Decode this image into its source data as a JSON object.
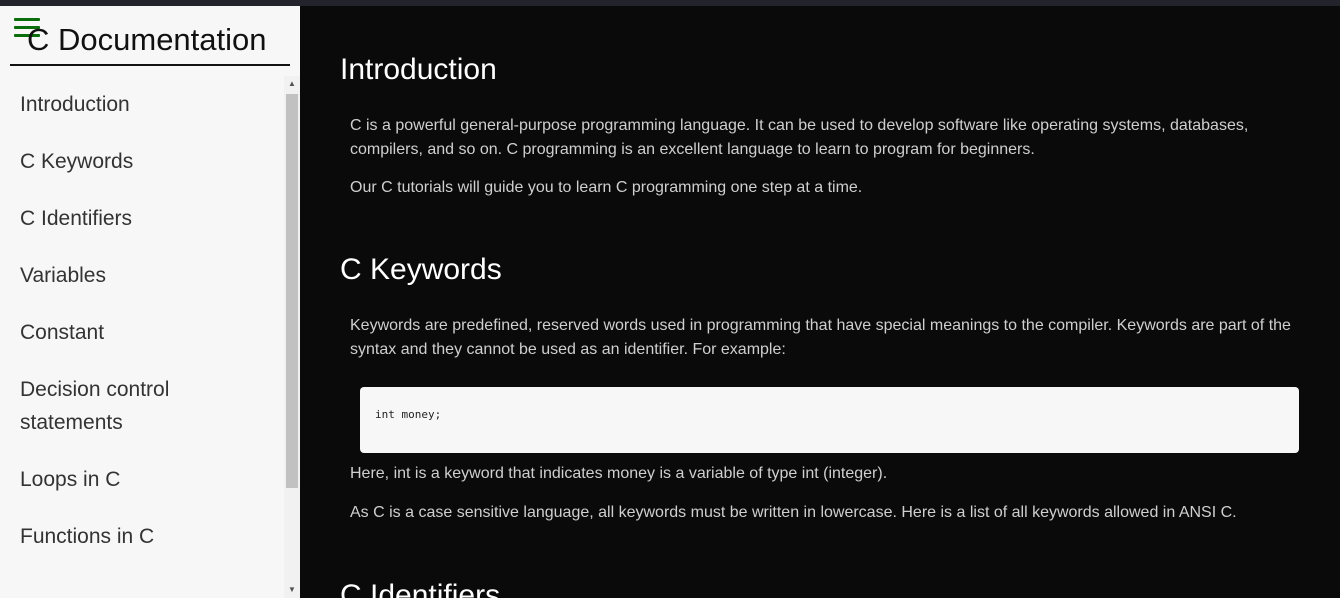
{
  "sidebar": {
    "title": "C Documentation",
    "menu_icon": "hamburger-icon",
    "items": [
      {
        "label": "Introduction"
      },
      {
        "label": "C Keywords"
      },
      {
        "label": "C Identifiers"
      },
      {
        "label": "Variables"
      },
      {
        "label": "Constant"
      },
      {
        "label": "Decision control statements"
      },
      {
        "label": "Loops in C"
      },
      {
        "label": "Functions in C"
      }
    ]
  },
  "main": {
    "sections": [
      {
        "heading": "Introduction",
        "paragraphs": [
          "C is a powerful general-purpose programming language. It can be used to develop software like operating systems, databases, compilers, and so on. C programming is an excellent language to learn to program for beginners.",
          "Our C tutorials will guide you to learn C programming one step at a time."
        ]
      },
      {
        "heading": "C Keywords",
        "paragraphs": [
          "Keywords are predefined, reserved words used in programming that have special meanings to the compiler. Keywords are part of the syntax and they cannot be used as an identifier. For example:",
          "Here, int is a keyword that indicates money is a variable of type int (integer).",
          "As C is a case sensitive language, all keywords must be written in lowercase. Here is a list of all keywords allowed in ANSI C."
        ],
        "code": "int money;"
      },
      {
        "heading": "C Identifiers"
      }
    ]
  },
  "colors": {
    "main_bg": "#0a0a0a",
    "sidebar_bg": "#f7f7f7",
    "accent": "#0a6e0a"
  }
}
